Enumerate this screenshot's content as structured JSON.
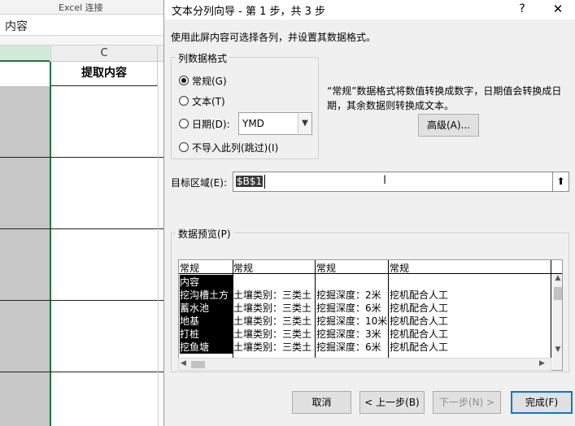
{
  "excel": {
    "top_strip_text": "Excel 连接",
    "formula_text": "内容",
    "column_header": "C",
    "header_cell": "提取内容"
  },
  "dialog": {
    "title": "文本分列向导 - 第 1 步，共 3 步",
    "help_icon": "?",
    "close_icon": "✕",
    "description": "使用此屏内容可选择各列，并设置其数据格式。",
    "format_group_label": "列数据格式",
    "radio_general": "常规(G)",
    "radio_text": "文本(T)",
    "radio_date": "日期(D):",
    "radio_skip": "不导入此列(跳过)(I)",
    "selected_format": "general",
    "date_format_value": "YMD",
    "hint_text": "“常规”数据格式将数值转换成数字，日期值会转换成日期，其余数据则转换成文本。",
    "advanced_button": "高级(A)...",
    "target_label": "目标区域(E):",
    "target_value": "$B$1",
    "preview_label": "数据预览(P)",
    "preview_headers": [
      "常规",
      "常规",
      "常规",
      "常规"
    ],
    "preview_rows": [
      [
        "内容",
        "",
        "",
        ""
      ],
      [
        "挖沟槽土方",
        "土壤类别：三类土",
        "挖掘深度：2米",
        "挖机配合人工"
      ],
      [
        "蓄水池",
        "土壤类别：三类土",
        "挖掘深度：6米",
        "挖机配合人工"
      ],
      [
        "地基",
        "土壤类别：三类土",
        "挖掘深度：10米",
        "挖机配合人工"
      ],
      [
        "打桩",
        "土壤类别：三类土",
        "挖掘深度：3米",
        "挖机配合人工"
      ],
      [
        "挖鱼塘",
        "土壤类别：三类土",
        "挖掘深度：6米",
        "挖机配合人工"
      ]
    ],
    "buttons": {
      "cancel": "取消",
      "back": "< 上一步(B)",
      "next": "下一步(N) >",
      "finish": "完成(F)"
    }
  }
}
